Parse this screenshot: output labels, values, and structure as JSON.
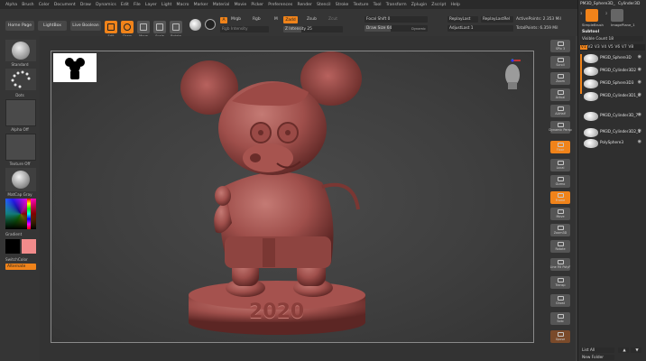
{
  "menu": [
    "Alpha",
    "Brush",
    "Color",
    "Document",
    "Draw",
    "Dynamics",
    "Edit",
    "File",
    "Layer",
    "Light",
    "Macro",
    "Marker",
    "Material",
    "Movie",
    "Picker",
    "Preferences",
    "Render",
    "Stencil",
    "Stroke",
    "Texture",
    "Tool",
    "Transform",
    "Zplugin",
    "Zscript",
    "Help"
  ],
  "top_right": {
    "tool_name": "PM3D_Sphere3D_",
    "tool_name2": "Cylinder3D",
    "simple_brush": "SimpleBrush",
    "image_plane": "ImagePlane_1",
    "count_a": "3",
    "count_b": "2"
  },
  "toolbar": {
    "home_page": "Home Page",
    "lightbox": "LightBox",
    "live_boolean": "Live Boolean",
    "tools": [
      "Edit",
      "Draw",
      "Move",
      "Scale",
      "Rotate"
    ],
    "a_label": "A",
    "mrgb": "Mrgb",
    "rgb": "Rgb",
    "rgb_intensity": "Rgb Intensity",
    "m_label": "M",
    "zadd": "Zadd",
    "zsub": "Zsub",
    "zcut": "Zcut",
    "z_intensity": "Z Intensity 25",
    "focal_shift": "Focal Shift 0",
    "draw_size": "Draw Size 64",
    "dynamic": "Dynamic",
    "replay_last": "ReplayLast",
    "replay_last_rel": "ReplayLastRel",
    "adjust_last": "AdjustLast 1",
    "active_points": "ActivePoints: 2.353 Mil",
    "total_points": "TotalPoints: 6.359 Mil"
  },
  "left_panel": {
    "standard": "Standard",
    "dots": "Dots",
    "alpha_off": "Alpha Off",
    "texture_off": "Texture Off",
    "matcap": "MatCap Gray",
    "gradient": "Gradient",
    "switch_color": "SwitchColor",
    "alternate": "Alternate"
  },
  "viewport": {
    "year_text": "2020",
    "model_color": "#b8625e"
  },
  "right_shelf": [
    "SPix 3",
    "Scroll",
    "Zoom",
    "Actual",
    "AAHalf",
    "Dynamic Persp",
    "Floor",
    "Local",
    "Gizmo",
    "Frame",
    "Move",
    "Zoom3D",
    "Rotate",
    "Line Fill PolyF",
    "Transp",
    "Ghost",
    "Solo",
    "Xpose"
  ],
  "subtool": {
    "title": "Subtool",
    "visible_count": "Visible Count 18",
    "tabs": [
      "V1",
      "V2",
      "V3",
      "V4",
      "V5",
      "V6",
      "V7",
      "V8"
    ],
    "items": [
      "PM3D_Sphere3D",
      "PM3D_Cylinder3D2",
      "PM3D_Sphere3D3",
      "PM3D_Cylinder3D1_4",
      "PM3D_Cylinder3D_7",
      "PM3D_Cylinder3D2_1",
      "PolySphere3"
    ],
    "list_all": "List All",
    "new_folder": "New Folder"
  },
  "colors": {
    "accent": "#f0831a",
    "bg": "#3b3b3b",
    "panel": "#353535",
    "secondary_color": "#f28b8b"
  }
}
